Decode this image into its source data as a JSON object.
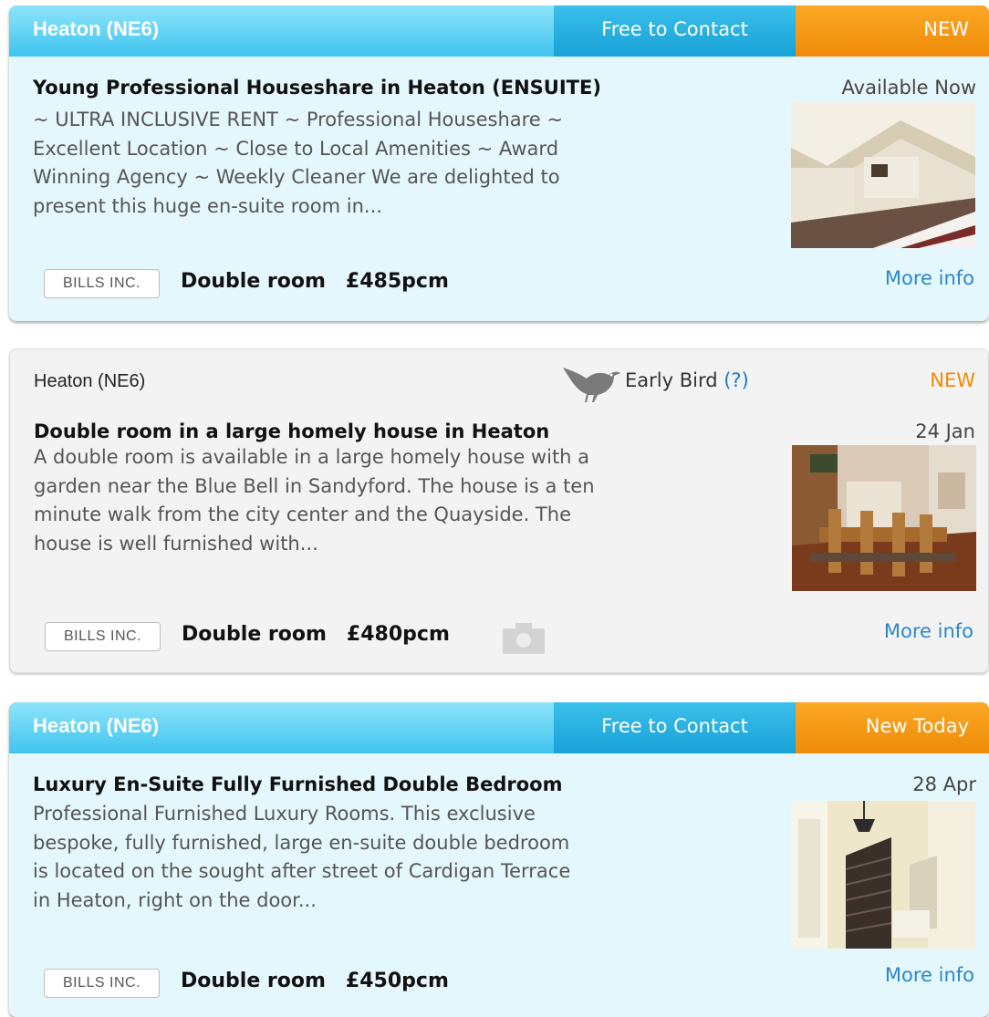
{
  "listings": [
    {
      "area": "Heaton (NE6)",
      "contact_badge": "Free to Contact",
      "new_badge": "NEW",
      "title": "Young Professional Houseshare in Heaton (ENSUITE)",
      "availability": "Available Now",
      "description_lines": [
        "~ ULTRA INCLUSIVE RENT ~ Professional Houseshare ~",
        "Excellent Location ~ Close to Local Amenities ~ Award",
        "Winning Agency ~ Weekly Cleaner We are delighted to",
        "present this huge en-suite room in..."
      ],
      "bills": "BILLS INC.",
      "room_type": "Double room",
      "price": "£485pcm",
      "more_info": "More info"
    },
    {
      "area": "Heaton (NE6)",
      "early_bird_label": "Early Bird",
      "early_bird_help": "(?)",
      "new_badge": "NEW",
      "title": "Double room in a large homely house in Heaton",
      "availability": "24 Jan",
      "description_lines": [
        "A double room is available in a large homely house with a",
        "garden near the Blue Bell in Sandyford. The house is a ten",
        "minute walk from the city center and the Quayside. The",
        "house is well furnished with..."
      ],
      "bills": "BILLS INC.",
      "room_type": "Double room",
      "price": "£480pcm",
      "more_info": "More info"
    },
    {
      "area": "Heaton (NE6)",
      "contact_badge": "Free to Contact",
      "new_badge": "New Today",
      "title": "Luxury En-Suite Fully Furnished Double Bedroom",
      "availability": "28 Apr",
      "description_lines": [
        "Professional Furnished Luxury Rooms. This exclusive",
        "bespoke, fully furnished, large en-suite double bedroom",
        "is located on the sought after street of Cardigan Terrace",
        "in Heaton, right on the door..."
      ],
      "bills": "BILLS INC.",
      "room_type": "Double room",
      "price": "£450pcm",
      "more_info": "More info"
    }
  ],
  "colors": {
    "header_light_blue": "#3fc4ef",
    "contact_blue": "#17a1d6",
    "new_orange": "#ee8b07",
    "featured_bg": "#e4f7fd",
    "plain_bg": "#f3f3f3",
    "link_blue": "#2d86cc"
  },
  "icons": [
    "early-bird-icon",
    "camera-icon"
  ]
}
